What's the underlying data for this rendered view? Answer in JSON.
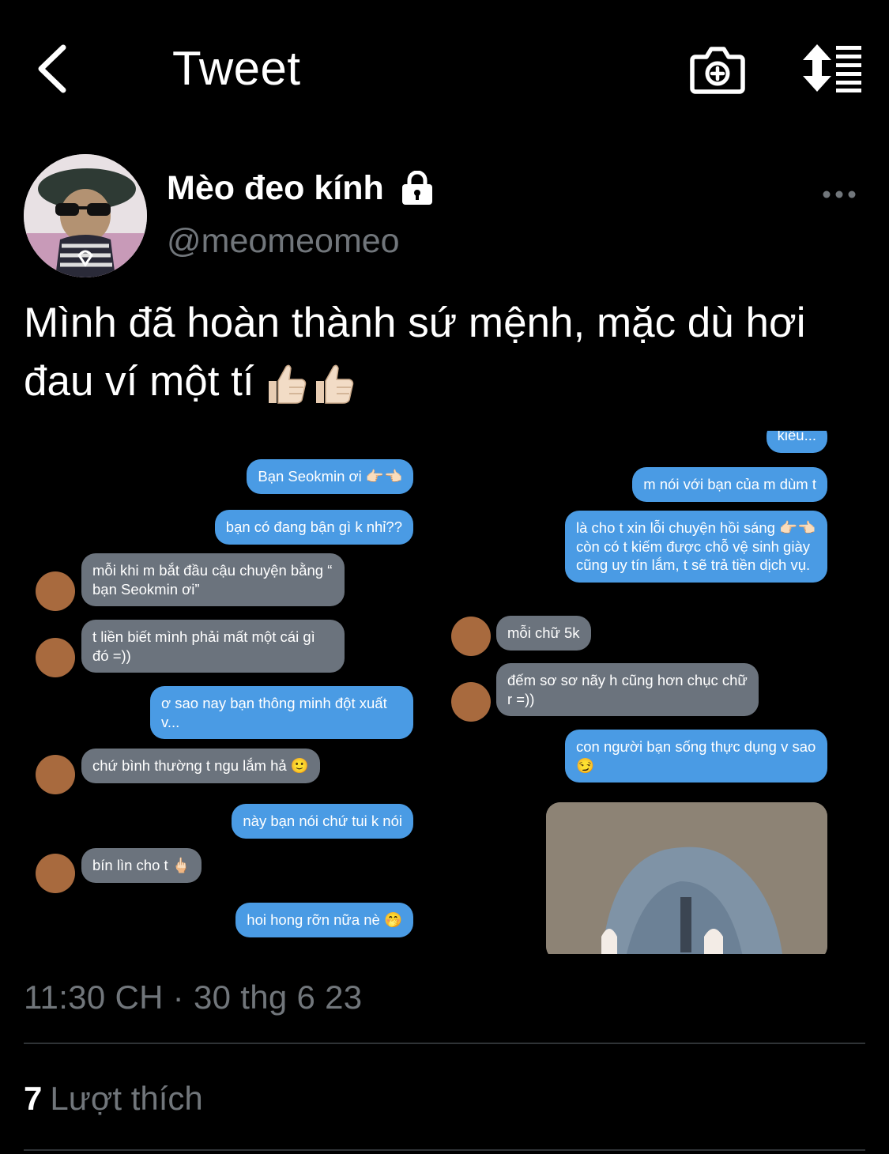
{
  "header": {
    "title": "Tweet",
    "back_icon": "chevron-left-icon",
    "camera_icon": "camera-plus-icon",
    "sort_icon": "sort-list-icon"
  },
  "author": {
    "display_name": "Mèo đeo kính",
    "handle": "@meomeomeo",
    "protected_icon": "lock-icon",
    "more_icon": "more-icon"
  },
  "tweet": {
    "text": "Mình đã hoàn thành sứ mệnh, mặc dù hơi đau ví một tí",
    "emoji": "👍🏻👍🏻"
  },
  "media": {
    "left": [
      {
        "side": "out",
        "text": "Bạn Seokmin ơi 👉🏻👈🏻"
      },
      {
        "side": "out",
        "text": "bạn có đang bận gì k nhỉ??"
      },
      {
        "side": "in",
        "text": "mỗi khi m bắt đầu cậu chuyện bằng “ bạn Seokmin ơi”"
      },
      {
        "side": "in",
        "text": "t liền biết mình phải mất một cái gì đó =))"
      },
      {
        "side": "out",
        "text": "ơ sao nay bạn thông minh đột xuất v..."
      },
      {
        "side": "in",
        "text": "chứ bình thường t ngu lắm hả 🙂"
      },
      {
        "side": "out",
        "text": "này bạn nói chứ tui k nói"
      },
      {
        "side": "in",
        "text": "bín lìn cho t 🖕🏻"
      },
      {
        "side": "out",
        "text": "hoi hong rỡn nữa nè 🤭"
      }
    ],
    "right": [
      {
        "side": "out",
        "text": "kiểu..."
      },
      {
        "side": "out",
        "text": "m nói với bạn của m dùm t"
      },
      {
        "side": "out",
        "text": "là cho t xin lỗi chuyện hồi sáng 👉🏻👈🏻 còn có t kiếm được chỗ vệ sinh giày cũng uy tín lắm, t sẽ trả tiền dịch vụ."
      },
      {
        "side": "in",
        "text": "mỗi chữ 5k"
      },
      {
        "side": "in",
        "text": "đếm sơ sơ nãy h cũng hơn chục chữ r =))"
      },
      {
        "side": "out",
        "text": "con người bạn sống thực dụng v sao 😏"
      }
    ],
    "colors": {
      "outgoing": "#4a9be4",
      "incoming": "#6b737d"
    }
  },
  "timestamp": "11:30 CH · 30 thg 6 23",
  "likes": {
    "count": "7",
    "label": "Lượt thích"
  }
}
